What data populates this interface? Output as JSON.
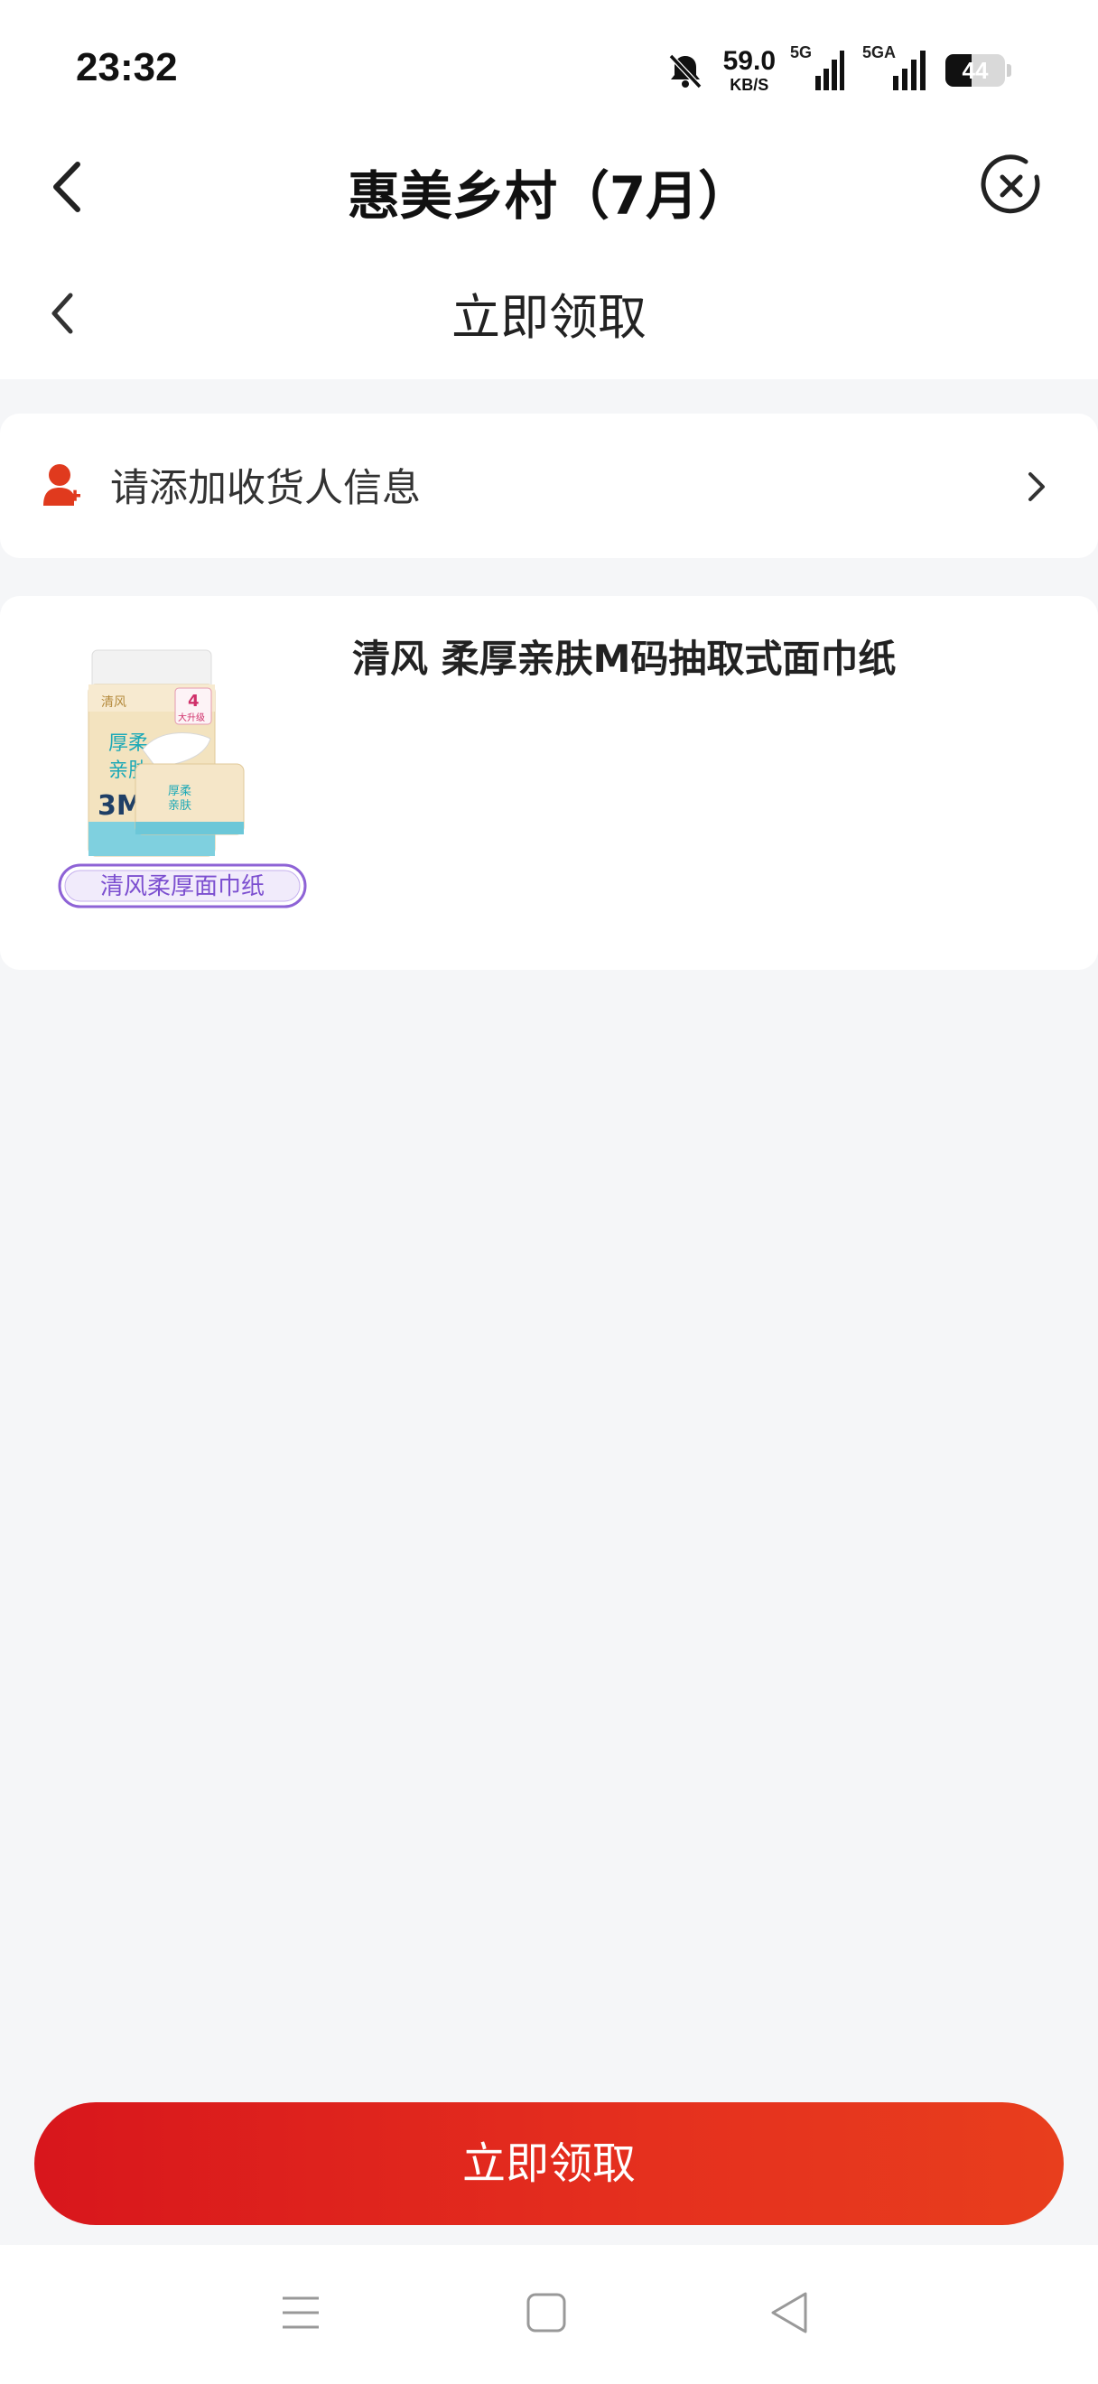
{
  "status_bar": {
    "time": "23:32",
    "net_speed_value": "59.0",
    "net_speed_unit": "KB/S",
    "signal1_label": "5G",
    "signal2_label": "5GA",
    "battery_level": "44",
    "battery_fraction": 0.44,
    "icons": [
      "bell-muted-icon",
      "signal-icon",
      "battery-icon"
    ]
  },
  "header": {
    "title": "惠美乡村（7月）",
    "back_icon": "chevron-left-icon",
    "close_icon": "close-circle-icon"
  },
  "subheader": {
    "title": "立即领取",
    "back_icon": "chevron-left-icon"
  },
  "address": {
    "label": "请添加收货人信息",
    "icon": "add-person-icon",
    "chevron_icon": "chevron-right-icon",
    "icon_color": "#e03a1e"
  },
  "product": {
    "name": "清风 柔厚亲肤M码抽取式面巾纸",
    "image_badge": "清风柔厚面巾纸",
    "pack_text_1": "厚柔",
    "pack_text_2": "亲肤",
    "pack_size": "3M",
    "pack_promo": "4",
    "pack_promo_sub": "大升级"
  },
  "actions": {
    "claim_label": "立即领取",
    "accent_color": "#e02a1d"
  },
  "system_nav": {
    "icons": [
      "menu-icon",
      "home-square-icon",
      "back-triangle-icon"
    ]
  }
}
